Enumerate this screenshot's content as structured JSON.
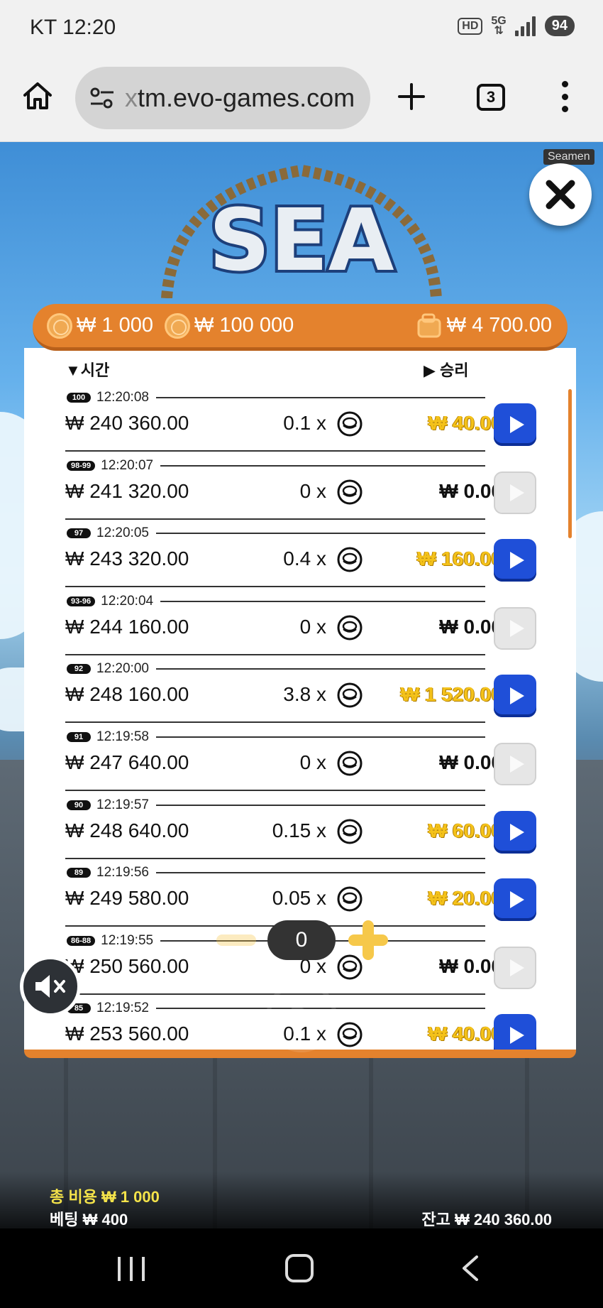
{
  "status_bar": {
    "carrier_time": "KT 12:20",
    "hd": "HD",
    "network": "5G",
    "battery": "94"
  },
  "browser": {
    "url_faded": "x",
    "url": "tm.evo-games.com",
    "tab_count": "3"
  },
  "game": {
    "provider_tag": "Seamen",
    "logo_text": "SEA"
  },
  "banner": {
    "stake_low": "₩ 1 000",
    "stake_high": "₩ 100 000",
    "wallet": "₩ 4 700.00"
  },
  "history": {
    "header_time": "시간",
    "header_win": "승리",
    "rows": [
      {
        "round": "100",
        "time": "12:20:08",
        "balance": "₩ 240 360.00",
        "multiplier": "0.1 x",
        "win": "₩ 40.00",
        "won": true
      },
      {
        "round": "98-99",
        "time": "12:20:07",
        "balance": "₩ 241 320.00",
        "multiplier": "0 x",
        "win": "₩ 0.00",
        "won": false
      },
      {
        "round": "97",
        "time": "12:20:05",
        "balance": "₩ 243 320.00",
        "multiplier": "0.4 x",
        "win": "₩ 160.00",
        "won": true
      },
      {
        "round": "93-96",
        "time": "12:20:04",
        "balance": "₩ 244 160.00",
        "multiplier": "0 x",
        "win": "₩ 0.00",
        "won": false
      },
      {
        "round": "92",
        "time": "12:20:00",
        "balance": "₩ 248 160.00",
        "multiplier": "3.8 x",
        "win": "₩ 1 520.00",
        "won": true
      },
      {
        "round": "91",
        "time": "12:19:58",
        "balance": "₩ 247 640.00",
        "multiplier": "0 x",
        "win": "₩ 0.00",
        "won": false
      },
      {
        "round": "90",
        "time": "12:19:57",
        "balance": "₩ 248 640.00",
        "multiplier": "0.15 x",
        "win": "₩ 60.00",
        "won": true
      },
      {
        "round": "89",
        "time": "12:19:56",
        "balance": "₩ 249 580.00",
        "multiplier": "0.05 x",
        "win": "₩ 20.00",
        "won": true
      },
      {
        "round": "86-88",
        "time": "12:19:55",
        "balance": "₩ 250 560.00",
        "multiplier": "0 x",
        "win": "₩ 0.00",
        "won": false
      },
      {
        "round": "85",
        "time": "12:19:52",
        "balance": "₩ 253 560.00",
        "multiplier": "0.1 x",
        "win": "₩ 40.00",
        "won": true
      }
    ]
  },
  "controls": {
    "stepper_value": "0",
    "total_cost": "총 비용  ₩ 1 000",
    "bet": "베팅  ₩ 400",
    "balance": "잔고  ₩ 240 360.00"
  },
  "colors": {
    "accent_orange": "#e4822d",
    "play_blue": "#1f4fd8",
    "win_gold": "#f4c21a"
  }
}
